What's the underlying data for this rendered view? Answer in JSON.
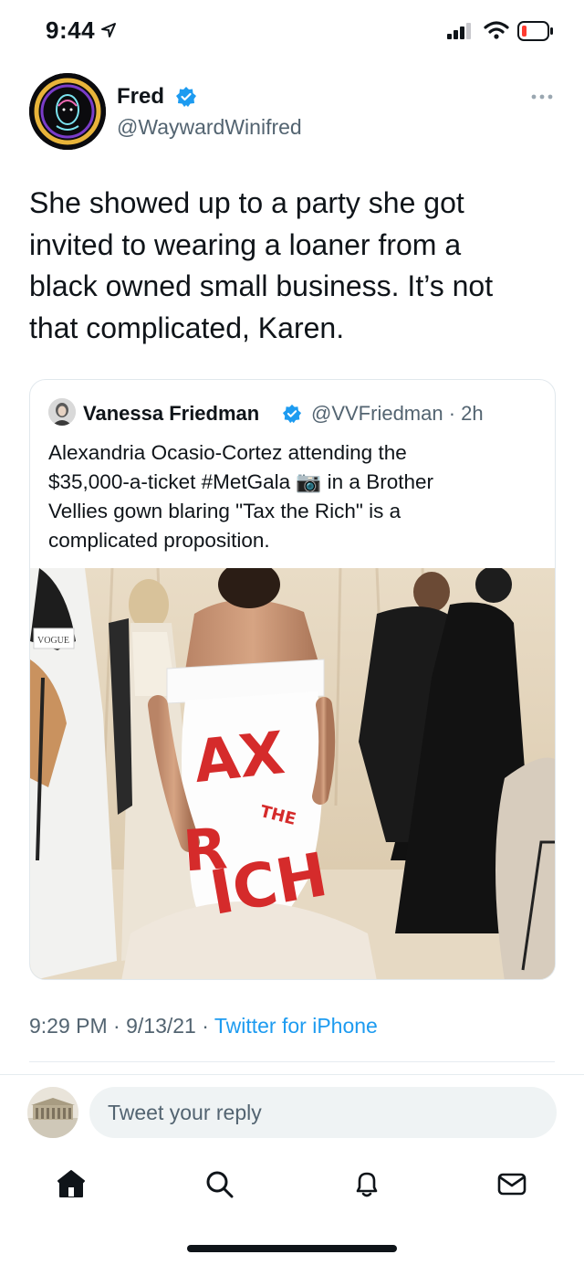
{
  "status_bar": {
    "time": "9:44"
  },
  "tweet": {
    "author": {
      "name": "Fred",
      "handle": "@WaywardWinifred"
    },
    "lines": [
      "She showed up to a party she got",
      "invited to wearing a loaner from a",
      "black owned small business. It’s not",
      "that complicated, Karen."
    ],
    "timestamp": "9:29 PM · 9/13/21 · ",
    "source": "Twitter for iPhone"
  },
  "quote": {
    "author": {
      "name": "Vanessa Friedman",
      "handle": "@VVFriedman · 2h"
    },
    "lines": [
      "Alexandria Ocasio-Cortez attending the",
      "$35,000-a-ticket #MetGala 📷 in a Brother",
      "Vellies gown blaring \"Tax the Rich\" is a",
      "complicated proposition."
    ],
    "image": {
      "dress_text_line1": "AX",
      "dress_text_line2": "THE",
      "dress_text_line3": "ICH",
      "dress_text_line0": "R",
      "badge": "VOGUE"
    }
  },
  "reply": {
    "placeholder": "Tweet your reply"
  },
  "nav": {
    "items": [
      "home-icon",
      "search-icon",
      "notifications-icon",
      "messages-icon"
    ]
  },
  "colors": {
    "accent": "#1d9bf0",
    "text": "#0f1419",
    "muted": "#536471",
    "dress_text": "#d52b2b"
  }
}
